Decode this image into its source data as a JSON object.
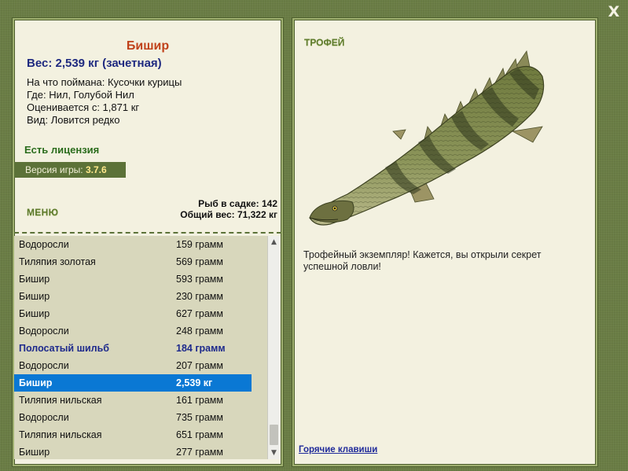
{
  "close_label": "X",
  "fish": {
    "name": "Бишир",
    "weight_line": "Вес: 2,539 кг (зачетная)",
    "bait": "На что поймана: Кусочки курицы",
    "location": "Где: Нил, Голубой Нил",
    "valued_from": "Оценивается с: 1,871 кг",
    "rarity": "Вид: Ловится редко"
  },
  "license": "Есть лицензия",
  "version": {
    "label": "Версия игры:",
    "value": "3.7.6"
  },
  "menu_label": "МЕНЮ",
  "stats": {
    "fish_in_keepnet": "Рыб в садке: 142",
    "total_weight": "Общий вес: 71,322 кг"
  },
  "catch_list": [
    {
      "name": "Водоросли",
      "weight": "159 грамм"
    },
    {
      "name": "Тиляпия золотая",
      "weight": "569 грамм"
    },
    {
      "name": "Бишир",
      "weight": "593 грамм"
    },
    {
      "name": "Бишир",
      "weight": "230 грамм"
    },
    {
      "name": "Бишир",
      "weight": "627 грамм"
    },
    {
      "name": "Водоросли",
      "weight": "248 грамм"
    },
    {
      "name": "Полосатый шильб",
      "weight": "184 грамм"
    },
    {
      "name": "Водоросли",
      "weight": "207 грамм"
    },
    {
      "name": "Бишир",
      "weight": "2,539 кг"
    },
    {
      "name": "Тиляпия нильская",
      "weight": "161 грамм"
    },
    {
      "name": "Водоросли",
      "weight": "735 грамм"
    },
    {
      "name": "Тиляпия нильская",
      "weight": "651 грамм"
    },
    {
      "name": "Бишир",
      "weight": "277 грамм"
    }
  ],
  "trophy": {
    "label": "ТРОФЕЙ",
    "text": "Трофейный экземпляр! Кажется, вы открыли секрет успешной ловли!"
  },
  "hotkeys": "Горячие клавиши",
  "colors": {
    "background": "#6a7d45",
    "panel": "#f3f1e0",
    "fish_name": "#c0421a",
    "weight": "#1f2a80",
    "license": "#2a6c1c",
    "selected_row": "#0a78d4",
    "highlight_row": "#1e2a8c"
  }
}
